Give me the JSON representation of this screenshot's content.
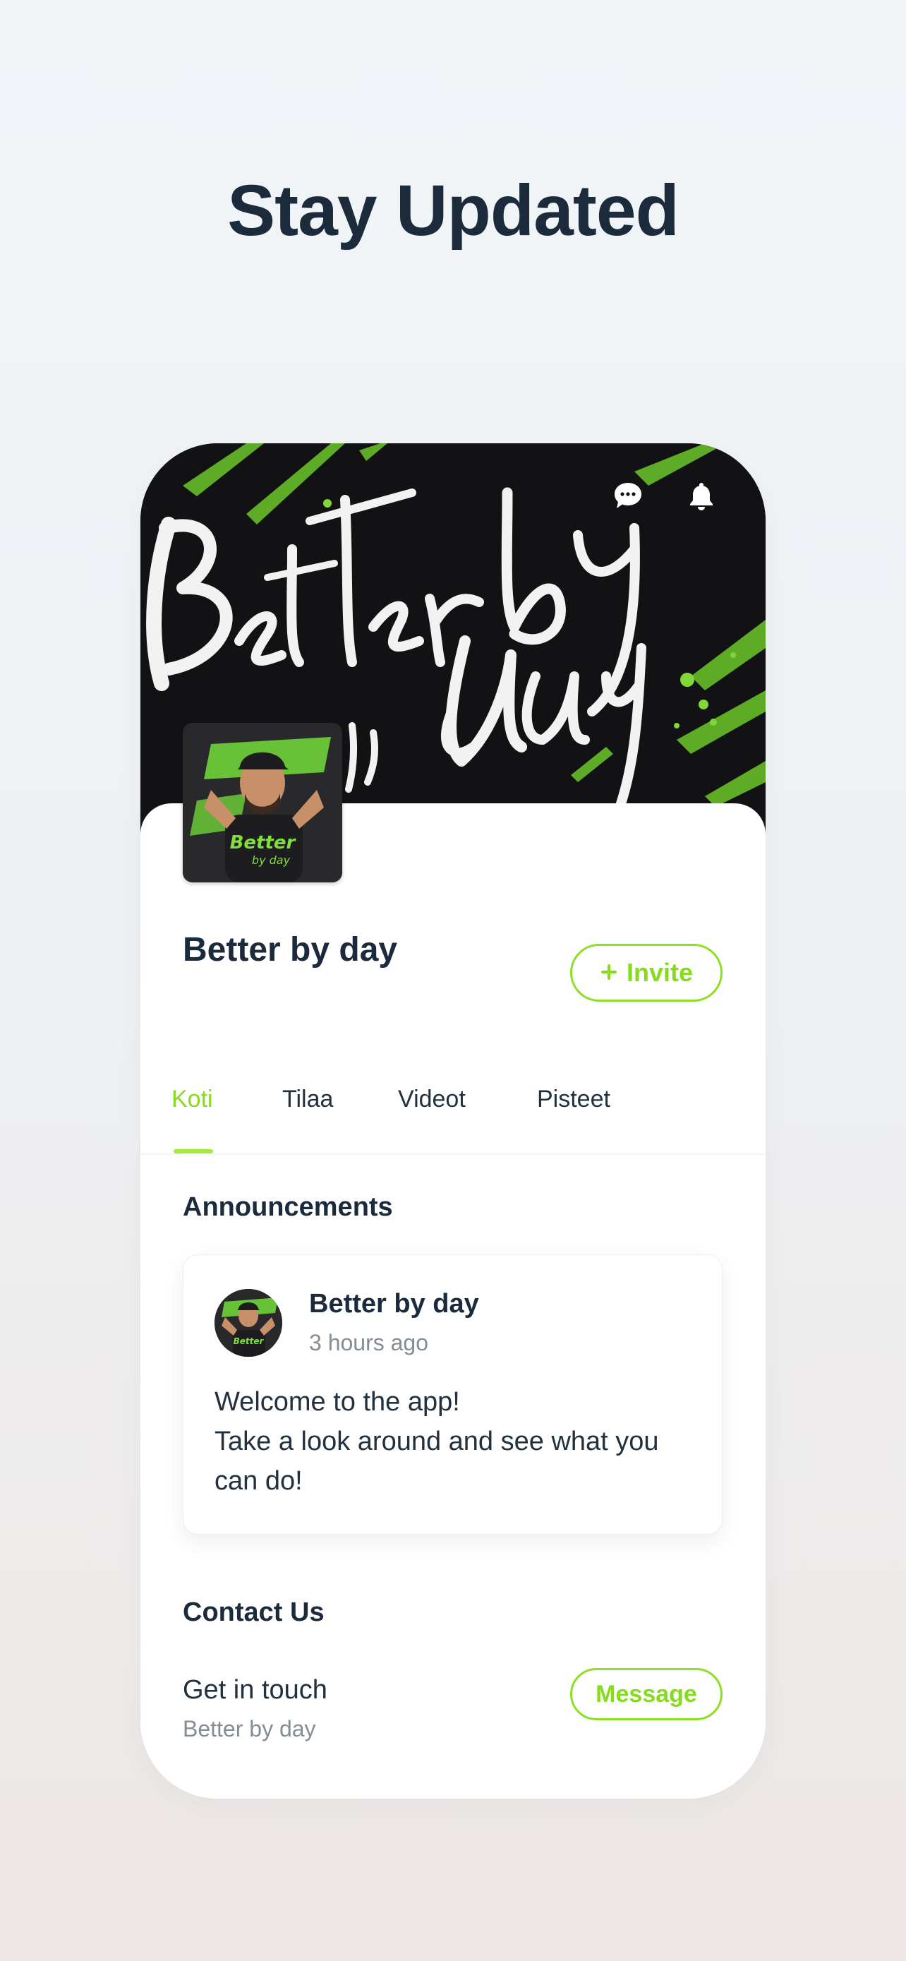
{
  "page": {
    "headline": "Stay Updated"
  },
  "banner": {
    "text": "Better by day",
    "icons": [
      "chat-bubble-icon",
      "bell-icon"
    ]
  },
  "avatar": {
    "name": "Better by day"
  },
  "group": {
    "title": "Better by day",
    "invite_label": "Invite",
    "invite_icon": "plus-icon"
  },
  "tabs": [
    {
      "label": "Koti",
      "active": true
    },
    {
      "label": "Tilaa",
      "active": false
    },
    {
      "label": "Videot",
      "active": false
    },
    {
      "label": "Pisteet",
      "active": false
    }
  ],
  "announcements": {
    "title": "Announcements",
    "post": {
      "author": "Better by day",
      "time": "3 hours ago",
      "body_lines": [
        "Welcome to the app!",
        "Take a look around and see what you",
        "can do!"
      ]
    }
  },
  "contact": {
    "title": "Contact Us",
    "heading": "Get in touch",
    "subtitle": "Better by day",
    "message_label": "Message"
  },
  "colors": {
    "accent": "#8BE022",
    "text_dark": "#1B2B3C",
    "text_muted": "#848C94",
    "banner_bg": "#121214"
  }
}
